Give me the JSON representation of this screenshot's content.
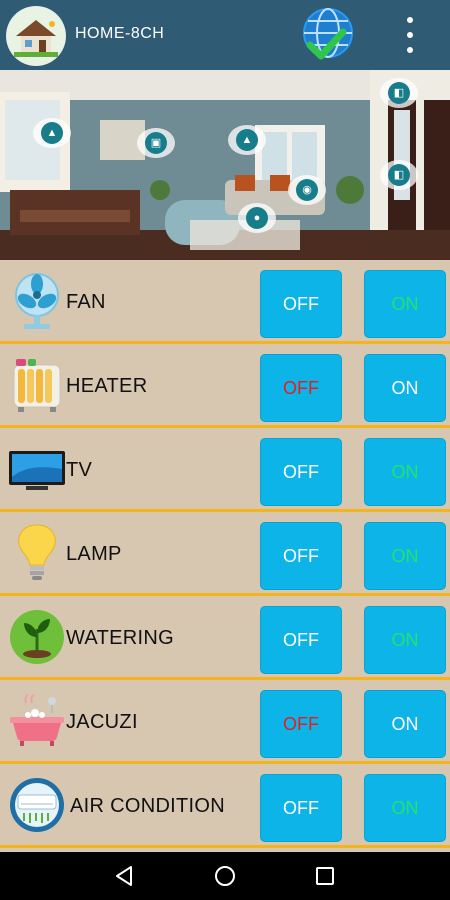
{
  "appbar": {
    "title": "HOME-8CH",
    "icons": {
      "logo": "house-logo-icon",
      "status": "globe-check-icon",
      "menu": "more-vert-icon"
    }
  },
  "hero": {
    "hotspot_icons": [
      "light-hotspot-icon",
      "tv-hotspot-icon",
      "light-hotspot-icon",
      "camera-hotspot-icon",
      "location-hotspot-icon",
      "door-hotspot-icon",
      "door-hotspot-icon"
    ]
  },
  "colors": {
    "appbar": "#2f5b74",
    "button": "#0cb4e8",
    "label_off_label": "#ffffff",
    "active_off": "#e02020",
    "active_on": "#1fe56a",
    "row_bg": "#d7c7b0",
    "divider": "#f2b51d"
  },
  "devices": [
    {
      "name": "FAN",
      "icon": "fan-icon",
      "off_label": "OFF",
      "on_label": "ON",
      "state": "on"
    },
    {
      "name": "HEATER",
      "icon": "heater-icon",
      "off_label": "OFF",
      "on_label": "ON",
      "state": "off"
    },
    {
      "name": "TV",
      "icon": "tv-icon",
      "off_label": "OFF",
      "on_label": "ON",
      "state": "on"
    },
    {
      "name": "LAMP",
      "icon": "lamp-icon",
      "off_label": "OFF",
      "on_label": "ON",
      "state": "on"
    },
    {
      "name": "WATERING",
      "icon": "plant-icon",
      "off_label": "OFF",
      "on_label": "ON",
      "state": "on"
    },
    {
      "name": "JACUZI",
      "icon": "bathtub-icon",
      "off_label": "OFF",
      "on_label": "ON",
      "state": "off"
    },
    {
      "name": "AIR CONDITION",
      "icon": "air-conditioner-icon",
      "off_label": "OFF",
      "on_label": "ON",
      "state": "on"
    }
  ],
  "navbar": {
    "icons": [
      "back-icon",
      "home-icon",
      "recents-icon"
    ]
  }
}
